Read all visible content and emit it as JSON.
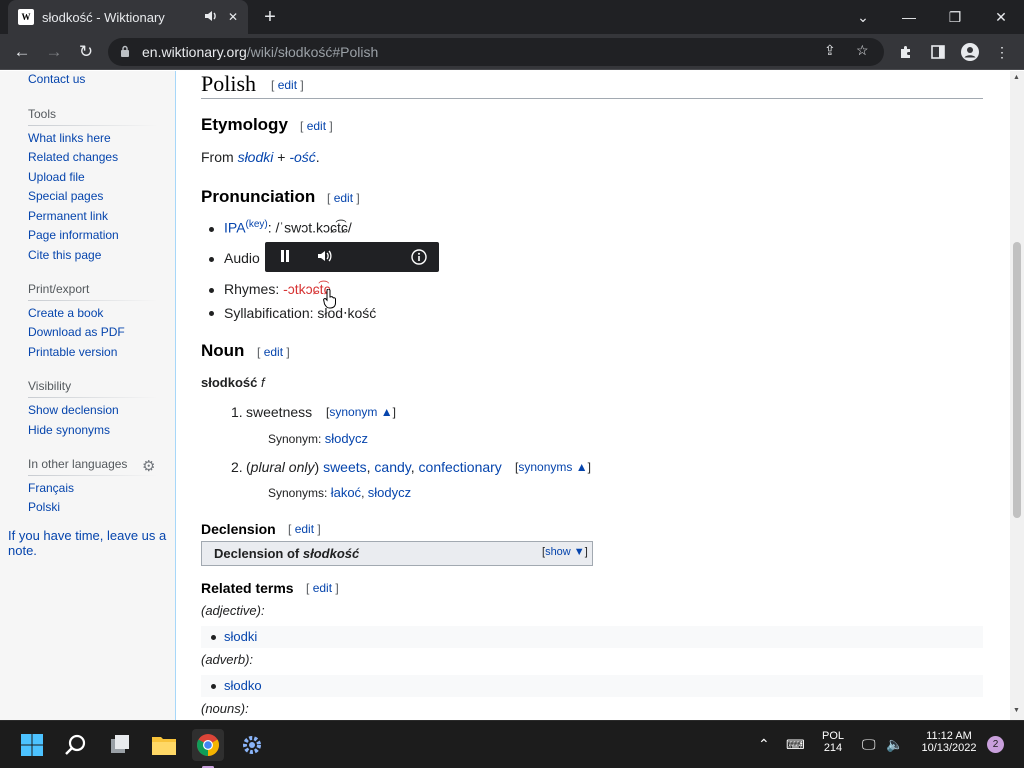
{
  "browser": {
    "tab_title": "słodkość - Wiktionary",
    "favicon_text": "W",
    "new_tab": "+",
    "url_host": "en.wiktionary.org",
    "url_path": "/wiki/słodkość#Polish"
  },
  "sidebar": {
    "contact": "Contact us",
    "tools_heading": "Tools",
    "tools": [
      "What links here",
      "Related changes",
      "Upload file",
      "Special pages",
      "Permanent link",
      "Page information",
      "Cite this page"
    ],
    "print_heading": "Print/export",
    "print": [
      "Create a book",
      "Download as PDF",
      "Printable version"
    ],
    "visibility_heading": "Visibility",
    "visibility": [
      "Show declension",
      "Hide synonyms"
    ],
    "languages_heading": "In other languages",
    "languages": [
      "Français",
      "Polski"
    ],
    "leave_note": "If you have time, leave us a note."
  },
  "article": {
    "edit_label": "edit",
    "bracket_open": "[",
    "bracket_close": "]",
    "language_heading": "Polish",
    "etymology_heading": "Etymology",
    "etymology": {
      "prefix": "From ",
      "link1": "słodki",
      "plus": " + ",
      "link2": "-ość",
      "suffix": "."
    },
    "pronunciation_heading": "Pronunciation",
    "ipa_label": "IPA",
    "ipa_key": "(key)",
    "ipa_value": ": /ˈswɔt.kɔɕt͡ɕ/",
    "audio_label": "Audio",
    "rhymes_label": "Rhymes: ",
    "rhymes_value": "-ɔtkɔɕt͡ɕ",
    "syllabification_label": "Syllabification: ",
    "syllabification_value": "słod‧kość",
    "noun_heading": "Noun",
    "headword": "słodkość",
    "gender": "f",
    "sense1": {
      "num": "1.",
      "gloss": "sweetness",
      "toggle": "synonym ▲",
      "syn_label": "Synonym: ",
      "syn": "słodycz"
    },
    "sense2": {
      "num": "2.",
      "qualifier_open": "(",
      "qualifier": "plural only",
      "qualifier_close": ")",
      "gloss1": "sweets",
      "gloss2": "candy",
      "gloss3": "confectionary",
      "sep": ", ",
      "toggle": "synonyms ▲",
      "syn_label": "Synonyms: ",
      "syn1": "łakoć",
      "syn2": "słodycz"
    },
    "declension_heading": "Declension",
    "declension_title_prefix": "Declension of ",
    "declension_title_word": "słodkość",
    "declension_show": "show ▼",
    "related_heading": "Related terms",
    "related": [
      {
        "pos": "(adjective):",
        "term": "słodki"
      },
      {
        "pos": "(adverb):",
        "term": "słodko"
      },
      {
        "pos": "(nouns):",
        "term": ""
      }
    ]
  },
  "audio_player": {
    "pause_icon": "pause-icon",
    "volume_icon": "volume-icon",
    "info_icon": "info-icon"
  },
  "taskbar": {
    "lang": "POL",
    "lang2": "214",
    "time": "11:12 AM",
    "date": "10/13/2022",
    "notifications": "2"
  }
}
